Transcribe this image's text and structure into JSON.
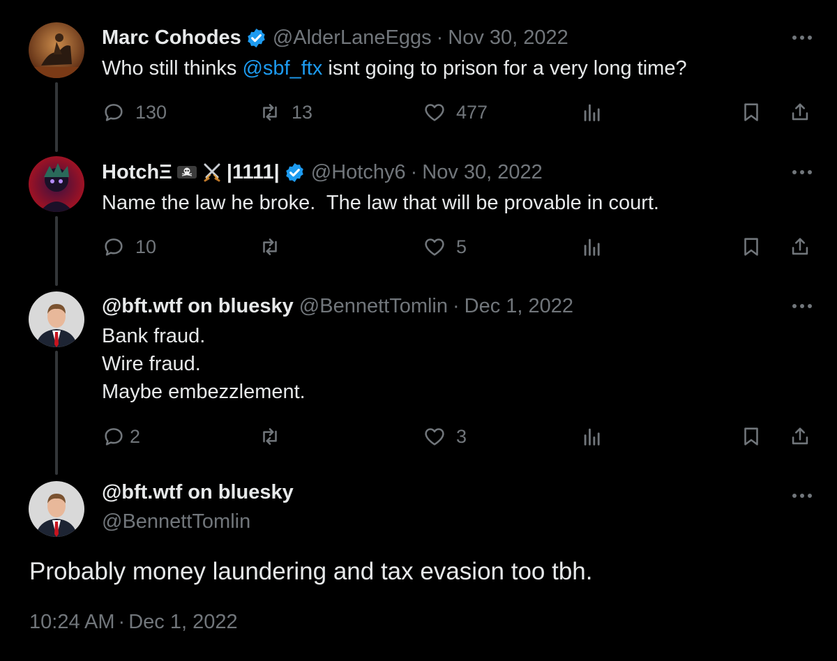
{
  "tweets": [
    {
      "name": "Marc Cohodes",
      "handle": "@AlderLaneEggs",
      "date": "Nov 30, 2022",
      "text_before": "Who still thinks ",
      "mention": "@sbf_ftx",
      "text_after": " isnt going to prison for a very long time?",
      "replies": "130",
      "retweets": "13",
      "likes": "477"
    },
    {
      "name": "HotchΞ",
      "name_suffix": "|1111|",
      "handle": "@Hotchy6",
      "date": "Nov 30, 2022",
      "text": "Name the law he broke.  The law that will be provable in court.",
      "replies": "10",
      "retweets": "",
      "likes": "5"
    },
    {
      "name": "@bft.wtf on bluesky",
      "handle": "@BennettTomlin",
      "date": "Dec 1, 2022",
      "lines": [
        "Bank fraud.",
        "Wire fraud.",
        "Maybe embezzlement."
      ],
      "replies": "2",
      "retweets": "",
      "likes": "3"
    }
  ],
  "main_tweet": {
    "name": "@bft.wtf on bluesky",
    "handle": "@BennettTomlin",
    "text": "Probably money laundering and tax evasion too tbh.",
    "time": "10:24 AM",
    "date": "Dec 1, 2022"
  },
  "separator": "·",
  "icons": [
    "verified-badge-icon",
    "skull-flag-emoji",
    "crossed-swords-emoji",
    "more-icon",
    "reply-icon",
    "retweet-icon",
    "like-icon",
    "views-icon",
    "bookmark-icon",
    "share-icon"
  ],
  "colors": {
    "background": "#000000",
    "text": "#e7e9ea",
    "muted": "#71767b",
    "accent": "#1d9bf0",
    "thread_line": "#333639"
  }
}
